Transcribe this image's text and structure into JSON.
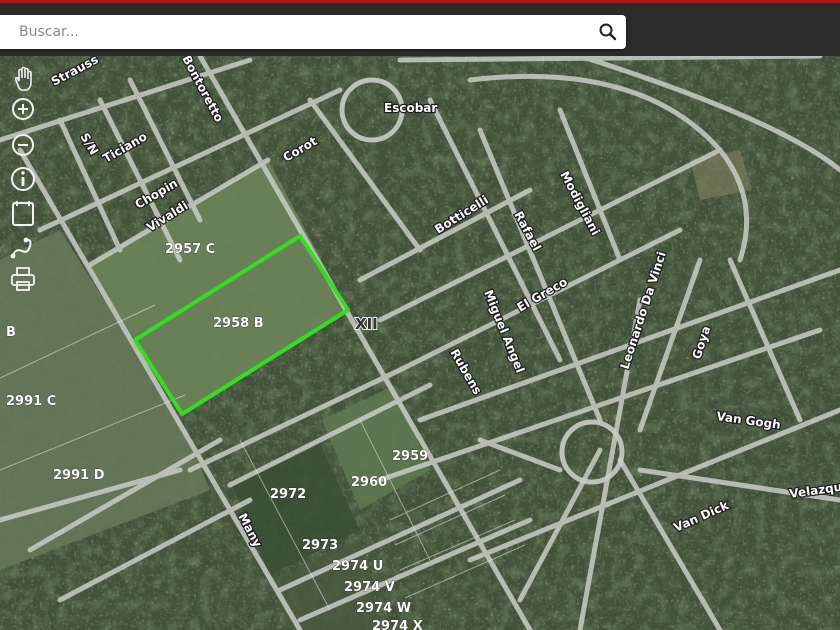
{
  "search": {
    "placeholder": "Buscar..."
  },
  "icons": {
    "search": "magnifier-icon",
    "tools": [
      "pan-hand-icon",
      "zoom-in-icon",
      "zoom-out-icon",
      "info-icon",
      "bookmark-icon",
      "measure-icon",
      "print-icon"
    ]
  },
  "colors": {
    "selection": "#33dd22",
    "road": "#cfd3cf",
    "label": "#ffffff",
    "topbar_accent": "#b01616"
  },
  "map": {
    "selected_parcel": "2958 B",
    "parcel_labels": [
      "2957 C",
      "2958 B",
      "B",
      "2991 C",
      "2991 D",
      "2959",
      "2972",
      "2960",
      "2973",
      "2974 U",
      "2974 V",
      "2974 W",
      "2974 X"
    ],
    "street_labels": [
      "Strauss",
      "Bontoretto",
      "S/N",
      "Ticiano",
      "Chopin",
      "Vivaldi",
      "Corot",
      "Escobar",
      "Botticelli",
      "Rafael",
      "Modigliani",
      "Leonardo Da Vinci",
      "Miguel Angel",
      "El Greco",
      "Rubens",
      "Goya",
      "Van Gogh",
      "Van Dick",
      "Velazqu",
      "Many"
    ],
    "zone_label": "XII"
  }
}
